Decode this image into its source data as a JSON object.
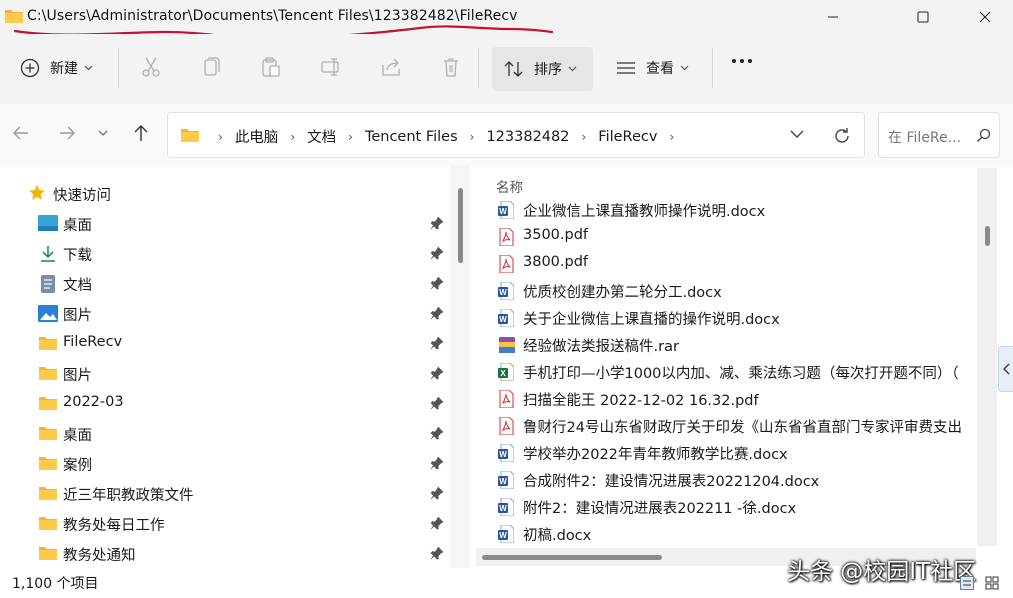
{
  "window": {
    "title_path": "C:\\Users\\Administrator\\Documents\\Tencent Files\\123382482\\FileRecv",
    "annotation_color": "#c8102e"
  },
  "commandbar": {
    "new_label": "新建",
    "sort_label": "排序",
    "view_label": "查看",
    "tool_icons": [
      "cut-icon",
      "copy-icon",
      "paste-icon",
      "rename-icon",
      "share-icon",
      "delete-icon"
    ]
  },
  "address": {
    "crumbs": [
      "此电脑",
      "文档",
      "Tencent Files",
      "123382482",
      "FileRecv"
    ],
    "search_placeholder": "在 FileRe..."
  },
  "sidebar": {
    "quick_access": "快速访问",
    "items": [
      {
        "label": "桌面",
        "icon": "desktop-icon",
        "pinned": true
      },
      {
        "label": "下载",
        "icon": "download-icon",
        "pinned": true
      },
      {
        "label": "文档",
        "icon": "document-icon",
        "pinned": true
      },
      {
        "label": "图片",
        "icon": "pictures-icon",
        "pinned": true
      },
      {
        "label": "FileRecv",
        "icon": "folder-icon",
        "pinned": true
      },
      {
        "label": "图片",
        "icon": "folder-icon",
        "pinned": true
      },
      {
        "label": "2022-03",
        "icon": "folder-icon",
        "pinned": true
      },
      {
        "label": "桌面",
        "icon": "folder-icon",
        "pinned": true
      },
      {
        "label": "案例",
        "icon": "folder-icon",
        "pinned": true
      },
      {
        "label": "近三年职教政策文件",
        "icon": "folder-icon",
        "pinned": true
      },
      {
        "label": "教务处每日工作",
        "icon": "folder-icon",
        "pinned": true
      },
      {
        "label": "教务处通知",
        "icon": "folder-icon",
        "pinned": true
      }
    ]
  },
  "files": {
    "column_name": "名称",
    "rows": [
      {
        "name": "企业微信上课直播教师操作说明.docx",
        "type": "word"
      },
      {
        "name": "3500.pdf",
        "type": "pdf"
      },
      {
        "name": "3800.pdf",
        "type": "pdf"
      },
      {
        "name": "优质校创建办第二轮分工.docx",
        "type": "word"
      },
      {
        "name": "关于企业微信上课直播的操作说明.docx",
        "type": "word"
      },
      {
        "name": "经验做法类报送稿件.rar",
        "type": "rar"
      },
      {
        "name": "手机打印—小学1000以内加、减、乘法练习题（每次打开题不同）（",
        "type": "excel"
      },
      {
        "name": "扫描全能王 2022-12-02 16.32.pdf",
        "type": "pdf"
      },
      {
        "name": "鲁财行24号山东省财政厅关于印发《山东省省直部门专家评审费支出",
        "type": "pdf"
      },
      {
        "name": "学校举办2022年青年教师教学比赛.docx",
        "type": "word"
      },
      {
        "name": "合成附件2：建设情况进展表20221204.docx",
        "type": "word"
      },
      {
        "name": "附件2：建设情况进展表202211 -徐.docx",
        "type": "word"
      },
      {
        "name": "初稿.docx",
        "type": "word"
      }
    ]
  },
  "status": {
    "item_count": "1,100 个项目",
    "watermark": "头条 @校园IT社区"
  }
}
